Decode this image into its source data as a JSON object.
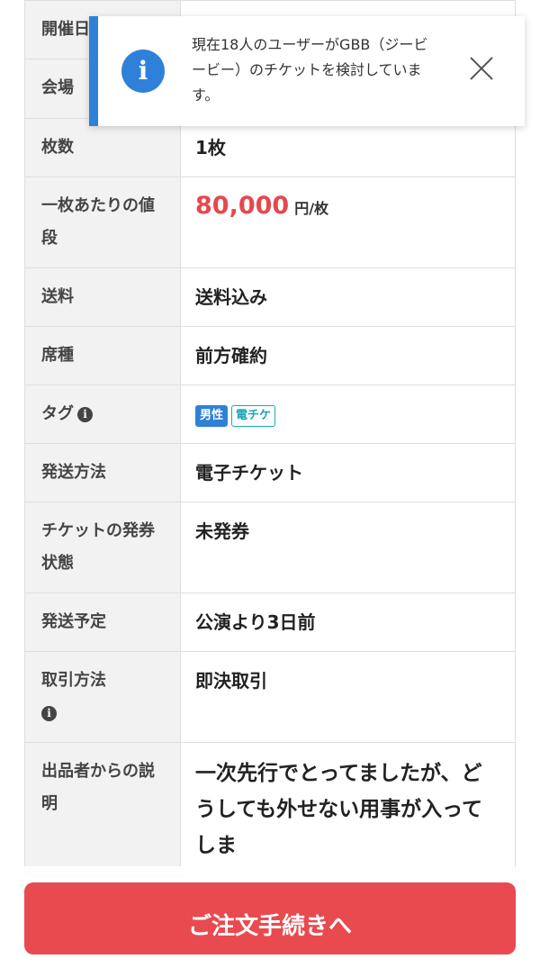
{
  "table": {
    "rows": [
      {
        "label": "開催日",
        "value": ""
      },
      {
        "label": "会場",
        "value": ""
      },
      {
        "label": "枚数",
        "value": "1枚"
      },
      {
        "label": "一枚あたりの値段",
        "price": "80,000",
        "unit": "円/枚"
      },
      {
        "label": "送料",
        "value": "送料込み"
      },
      {
        "label": "席種",
        "value": "前方確約"
      },
      {
        "label": "タグ",
        "info": "i",
        "tags": [
          "男性",
          "電チケ"
        ]
      },
      {
        "label": "発送方法",
        "value": "電子チケット"
      },
      {
        "label": "チケットの発券状態",
        "value": "未発券"
      },
      {
        "label": "発送予定",
        "value": "公演より3日前"
      },
      {
        "label": "取引方法",
        "info": "i",
        "value": "即決取引"
      },
      {
        "label": "出品者からの説明",
        "value": "一次先行でとってましたが、どうしても外せない用事が入ってしま"
      }
    ]
  },
  "toast": {
    "icon": "info-icon",
    "icon_glyph": "i",
    "message": "現在18人のユーザーがGBB（ジービービー）のチケットを検討しています。",
    "close_icon": "close-icon",
    "accent": "#2f80d8"
  },
  "order_button": {
    "label": "ご注文手続きへ",
    "color": "#e84a4f"
  }
}
